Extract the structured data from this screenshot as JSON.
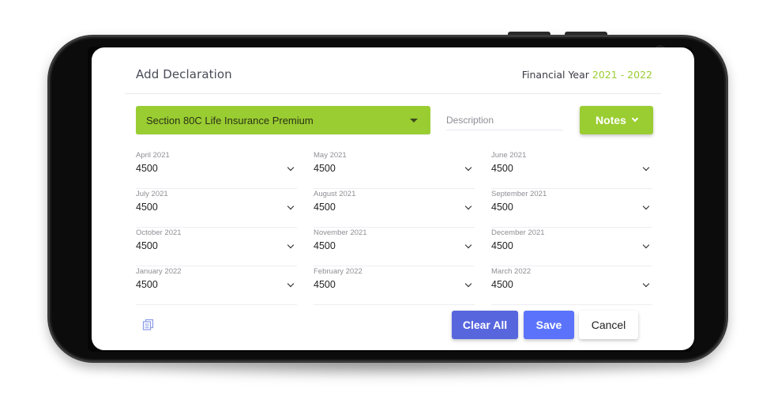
{
  "dialog": {
    "title": "Add Declaration",
    "financial_year_label": "Financial Year",
    "financial_year_value": "2021 - 2022"
  },
  "category": {
    "selected": "Section 80C Life Insurance Premium"
  },
  "description": {
    "placeholder": "Description",
    "value": ""
  },
  "notes_button": {
    "label": "Notes"
  },
  "months": [
    {
      "label": "April 2021",
      "value": "4500"
    },
    {
      "label": "May 2021",
      "value": "4500"
    },
    {
      "label": "June 2021",
      "value": "4500"
    },
    {
      "label": "July 2021",
      "value": "4500"
    },
    {
      "label": "August 2021",
      "value": "4500"
    },
    {
      "label": "September 2021",
      "value": "4500"
    },
    {
      "label": "October 2021",
      "value": "4500"
    },
    {
      "label": "November 2021",
      "value": "4500"
    },
    {
      "label": "December 2021",
      "value": "4500"
    },
    {
      "label": "January 2022",
      "value": "4500"
    },
    {
      "label": "February 2022",
      "value": "4500"
    },
    {
      "label": "March 2022",
      "value": "4500"
    }
  ],
  "actions": {
    "copy_icon": "copy-icon",
    "clear_all": "Clear All",
    "save": "Save",
    "cancel": "Cancel"
  },
  "colors": {
    "accent_green": "#9acd32",
    "clear_all_bg": "#5866de",
    "save_bg": "#5b73fb",
    "copy_icon": "#8a9be8"
  }
}
